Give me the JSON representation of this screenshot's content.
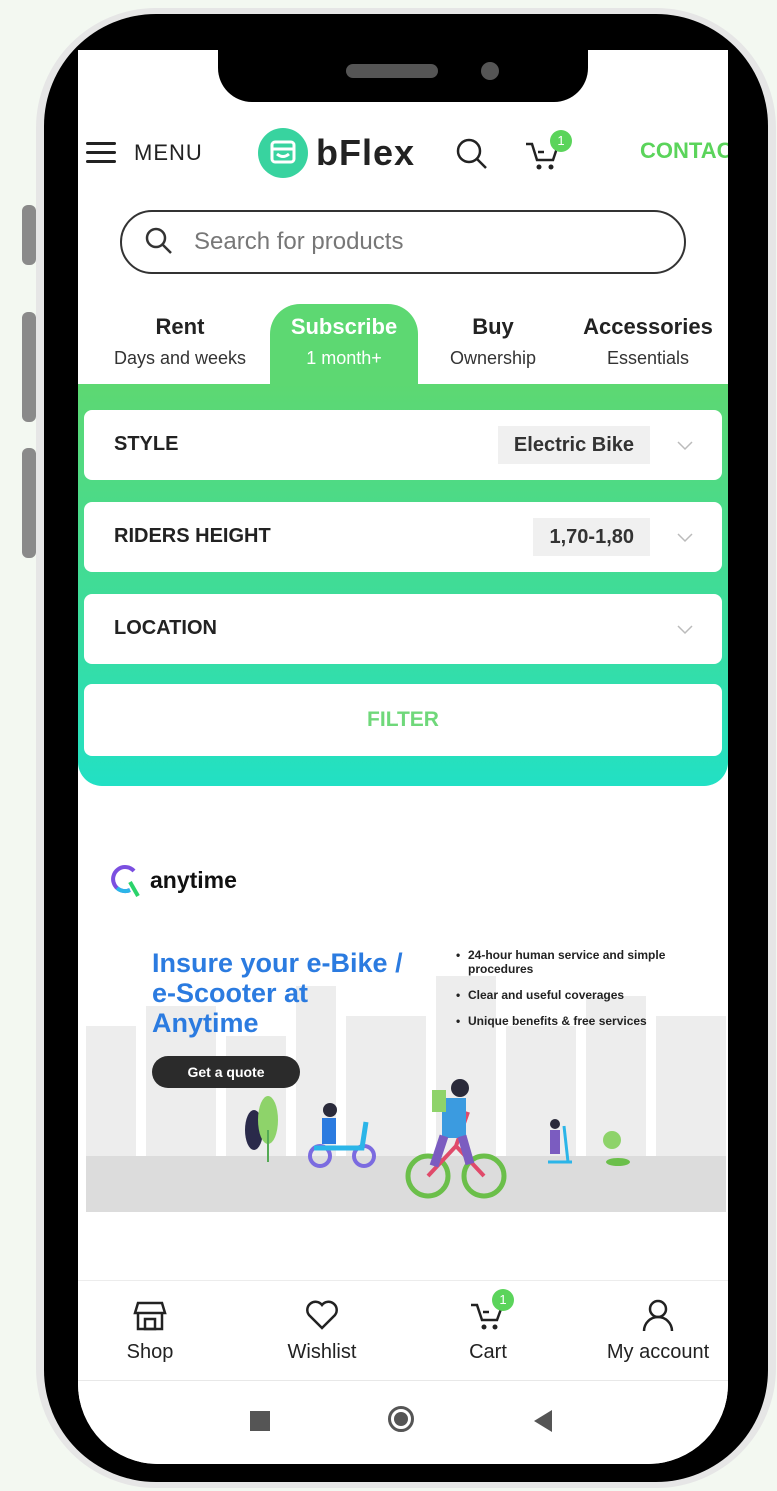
{
  "header": {
    "menu_label": "MENU",
    "logo_text": "bFlex",
    "cart_count": "1",
    "contact_label": "CONTAC",
    "accent_color": "#5bd45b"
  },
  "search": {
    "placeholder": "Search for products"
  },
  "tabs": [
    {
      "label": "Rent",
      "sublabel": "Days and weeks",
      "active": false
    },
    {
      "label": "Subscribe",
      "sublabel": "1 month+",
      "active": true
    },
    {
      "label": "Buy",
      "sublabel": "Ownership",
      "active": false
    },
    {
      "label": "Accessories",
      "sublabel": "Essentials",
      "active": false
    }
  ],
  "filters": {
    "style": {
      "label": "STYLE",
      "value": "Electric Bike"
    },
    "riders_height": {
      "label": "RIDERS HEIGHT",
      "value": "1,70-1,80"
    },
    "location": {
      "label": "LOCATION",
      "value": ""
    },
    "button_label": "FILTER"
  },
  "ad": {
    "brand": "anytime",
    "headline": [
      "Insure your e-Bike /",
      "e-Scooter at",
      "Anytime"
    ],
    "cta": "Get a quote",
    "bullets": [
      "24-hour human service and simple procedures",
      "Clear and useful coverages",
      "Unique benefits & free services"
    ]
  },
  "bottom_nav": [
    {
      "label": "Shop",
      "icon": "shop-icon"
    },
    {
      "label": "Wishlist",
      "icon": "heart-icon"
    },
    {
      "label": "Cart",
      "icon": "cart-icon",
      "badge": "1"
    },
    {
      "label": "My account",
      "icon": "user-icon"
    }
  ],
  "system_nav": {
    "recents": "square-icon",
    "home": "circle-icon",
    "back": "triangle-icon"
  }
}
